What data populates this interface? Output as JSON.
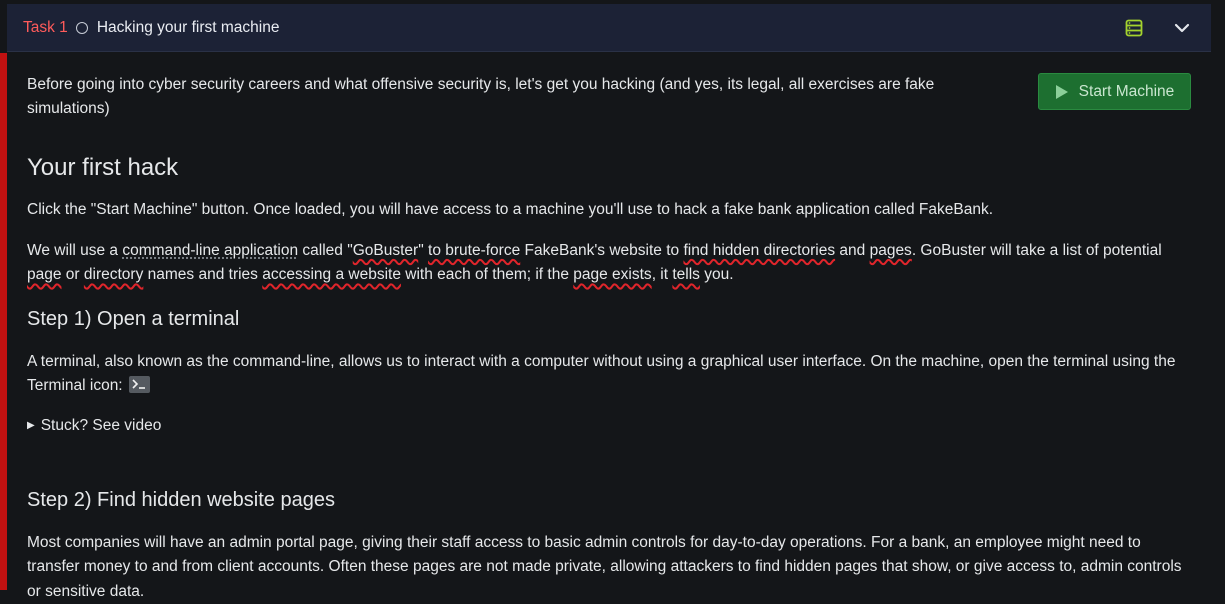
{
  "header": {
    "task_label": "Task 1",
    "task_title": "Hacking your first machine",
    "icons": [
      "circle-icon",
      "server-icon",
      "chevron-down-icon"
    ]
  },
  "intro": {
    "text": "Before going into cyber security careers and what offensive security is, let's get you hacking (and yes, its legal, all exercises are fake simulations)",
    "start_button": "Start Machine"
  },
  "section1": {
    "heading": "Your first hack",
    "p1": "Click the \"Start Machine\" button. Once loaded, you will have access to a machine you'll use to hack a fake bank application called FakeBank.",
    "p2": {
      "t1": "We will use a ",
      "link_cli": "command-line application",
      "t2": " called \"",
      "gobuster": "GoBuster",
      "t3": "\" ",
      "to_brute": "to brute-force",
      "t4": " FakeBank's website to ",
      "find_hidden": "find hidden directories",
      "t5": " and ",
      "pages": "pages",
      "t6": ". GoBuster will take a list of potential ",
      "page": "page",
      "t7": " or ",
      "directory": "directory",
      "t8": " names and tries ",
      "accessing": "accessing a website",
      "t9": " with each of them; if the ",
      "page_exists": "page exists",
      "t10": ", it ",
      "tells": "tells",
      "t11": " you."
    }
  },
  "step1": {
    "heading": "Step 1) Open a terminal",
    "text": "A terminal, also known as the command-line, allows us to interact with a computer without using a graphical user interface. On the machine, open the terminal using the Terminal icon: ",
    "details": "Stuck? See video"
  },
  "step2": {
    "heading": "Step 2) Find hidden website pages",
    "text": "Most companies will have an admin portal page, giving their staff access to basic admin controls for day-to-day operations. For a bank, an employee might need to transfer money to and from client accounts. Often these pages are not made private, allowing attackers to find hidden pages that show, or give access to, admin controls or sensitive data."
  },
  "colors": {
    "task_label": "#ff5b5b",
    "accent_red": "#c11111",
    "button_green": "#1d6f30",
    "server_icon": "#a4d32e"
  }
}
